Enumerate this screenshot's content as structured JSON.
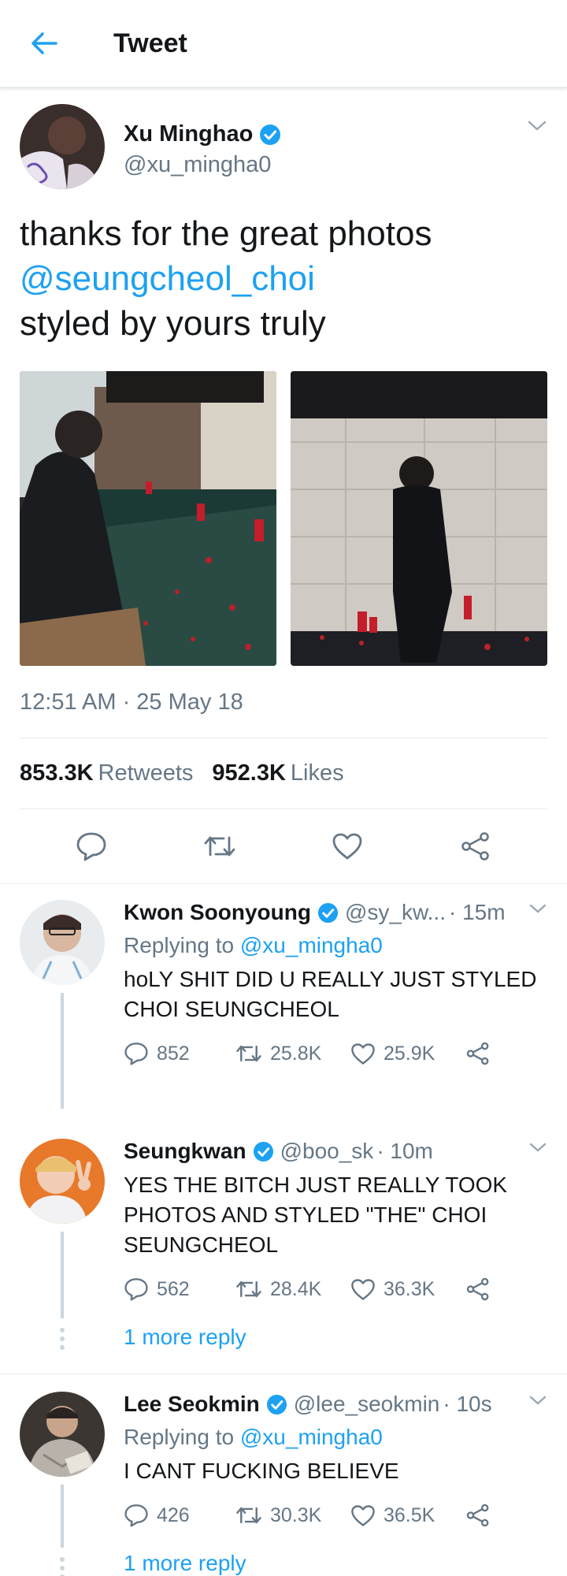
{
  "header": {
    "title": "Tweet"
  },
  "tweet": {
    "name": "Xu Minghao",
    "handle": "@xu_mingha0",
    "text_line1": "thanks for the great photos",
    "mention": "@seungcheol_choi",
    "text_line3": "styled by yours truly",
    "timestamp": "12:51 AM · 25 May 18",
    "retweets_count": "853.3K",
    "retweets_label": "Retweets",
    "likes_count": "952.3K",
    "likes_label": "Likes"
  },
  "replies": [
    {
      "name": "Kwon Soonyoung",
      "handle": "@sy_kw...",
      "time": "· 15m",
      "replying_prefix": "Replying to",
      "replying_to": "@xu_mingha0",
      "text": "hoLY SHIT DID U REALLY JUST STYLED CHOI SEUNGCHEOL",
      "comments": "852",
      "retweets": "25.8K",
      "likes": "25.9K"
    },
    {
      "name": "Seungkwan",
      "handle": "@boo_sk",
      "time": "· 10m",
      "text": "YES THE BITCH JUST REALLY TOOK PHOTOS AND STYLED \"THE\" CHOI SEUNGCHEOL",
      "comments": "562",
      "retweets": "28.4K",
      "likes": "36.3K",
      "more": "1 more reply"
    },
    {
      "name": "Lee Seokmin",
      "handle": "@lee_seokmin",
      "time": "· 10s",
      "replying_prefix": "Replying to",
      "replying_to": "@xu_mingha0",
      "text": "I CANT FUCKING BELIEVE",
      "comments": "426",
      "retweets": "30.3K",
      "likes": "36.5K",
      "more": "1 more reply"
    }
  ],
  "colors": {
    "accent": "#1da1f2",
    "muted": "#657786",
    "border": "#e6ecf0",
    "text": "#14171a"
  },
  "icons": [
    "back-arrow-icon",
    "verified-badge-icon",
    "chevron-down-icon",
    "reply-icon",
    "retweet-icon",
    "like-icon",
    "share-icon"
  ]
}
